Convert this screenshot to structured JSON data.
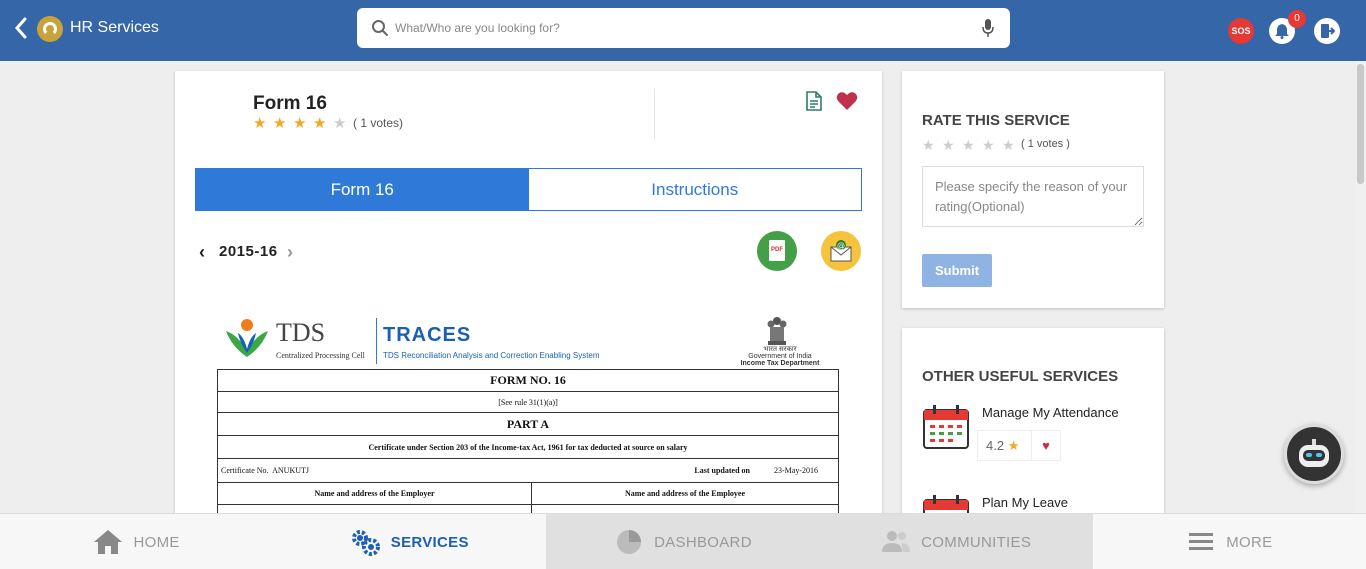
{
  "header": {
    "title": "HR Services",
    "search_placeholder": "What/Who are you looking for?",
    "sos_label": "SOS",
    "notification_count": "0",
    "colors": {
      "bar": "#3466a8",
      "sos": "#e53935"
    }
  },
  "main": {
    "title": "Form 16",
    "rating": 4,
    "votes": "( 1 votes)",
    "tabs": [
      {
        "label": "Form 16",
        "active": true
      },
      {
        "label": "Instructions",
        "active": false
      }
    ],
    "year": "2015-16",
    "pdf_label": "PDF",
    "document": {
      "tds_title": "TDS",
      "tds_subtitle": "Centralized Processing Cell",
      "traces_title": "TRACES",
      "traces_subtitle": "TDS Reconciliation Analysis and Correction Enabling System",
      "gov_hindi": "भारत सरकार",
      "gov_line1": "Government of India",
      "gov_line2": "Income Tax Department",
      "form_no": "FORM NO. 16",
      "rule": "[See rule 31(1)(a)]",
      "part": "PART A",
      "certificate_text": "Certificate under Section 203 of the Income-tax Act, 1961 for tax deducted at source on salary",
      "certificate_no_label": "Certificate No.",
      "certificate_no": "ANUKUTJ",
      "last_updated_label": "Last updated on",
      "last_updated": "23-May-2016",
      "employer_header": "Name and address of the Employer",
      "employee_header": "Name and address of the Employee"
    }
  },
  "rate": {
    "title": "RATE THIS SERVICE",
    "votes": "( 1 votes )",
    "reason_placeholder": "Please specify the reason of your rating(Optional)",
    "submit_label": "Submit"
  },
  "other_services": {
    "title": "OTHER USEFUL SERVICES",
    "items": [
      {
        "name": "Manage My Attendance",
        "rating": "4.2"
      },
      {
        "name": "Plan My Leave"
      }
    ]
  },
  "bottom_nav": [
    {
      "label": "HOME",
      "icon": "home-icon"
    },
    {
      "label": "SERVICES",
      "icon": "gears-icon",
      "active": true
    },
    {
      "label": "DASHBOARD",
      "icon": "pie-chart-icon"
    },
    {
      "label": "COMMUNITIES",
      "icon": "people-icon"
    },
    {
      "label": "MORE",
      "icon": "menu-icon"
    }
  ],
  "accent_colors": {
    "primary": "#2f7ad8",
    "nav_active": "#1e5fb4",
    "star": "#f5a623",
    "heart": "#c0304b"
  }
}
